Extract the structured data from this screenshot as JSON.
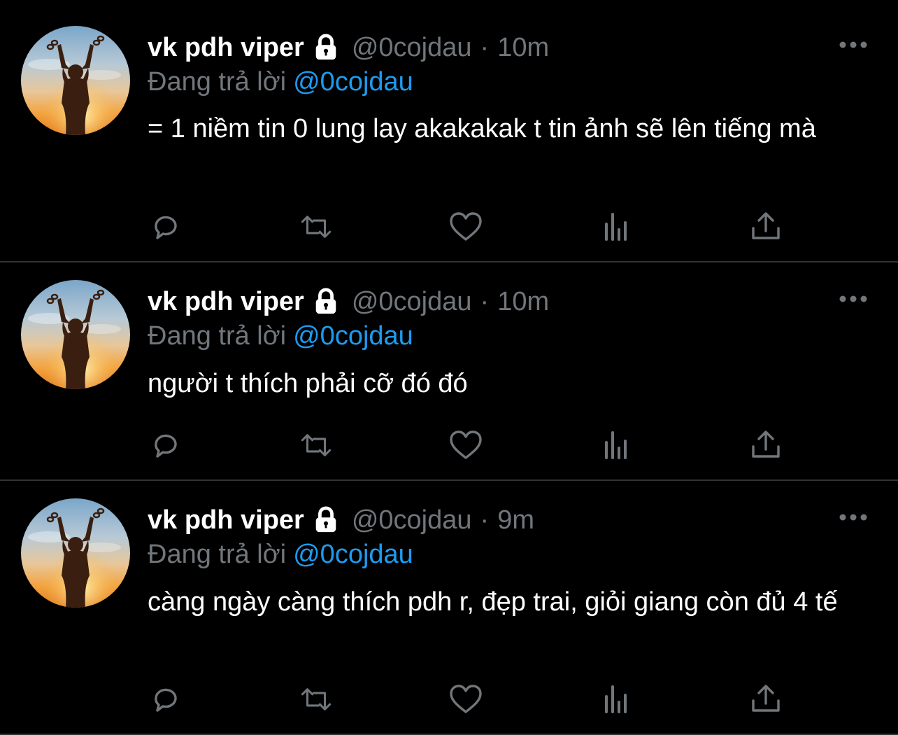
{
  "colors": {
    "background": "#000000",
    "name": "#ffffff",
    "muted": "#71767b",
    "link": "#1d9bf0",
    "divider": "#2f3336"
  },
  "tweets": [
    {
      "display_name": "vk pdh viper",
      "handle": "@0cojdau",
      "separator": "·",
      "time": "10m",
      "reply_prefix": "Đang trả lời",
      "reply_to": "@0cojdau",
      "text": "= 1 niềm tin 0 lung lay akakakak t tin ảnh sẽ lên tiếng mà"
    },
    {
      "display_name": "vk pdh viper",
      "handle": "@0cojdau",
      "separator": "·",
      "time": "10m",
      "reply_prefix": "Đang trả lời",
      "reply_to": "@0cojdau",
      "text": "người t thích phải cỡ đó đó"
    },
    {
      "display_name": "vk pdh viper",
      "handle": "@0cojdau",
      "separator": "·",
      "time": "9m",
      "reply_prefix": "Đang trả lời",
      "reply_to": "@0cojdau",
      "text": "càng ngày càng thích pdh r, đẹp trai, giỏi giang còn đủ 4 tế"
    }
  ],
  "icons": {
    "lock": "lock-icon",
    "more": "more-dots-icon",
    "reply": "reply-icon",
    "retweet": "retweet-icon",
    "like": "heart-icon",
    "views": "views-bar-icon",
    "share": "share-icon"
  }
}
